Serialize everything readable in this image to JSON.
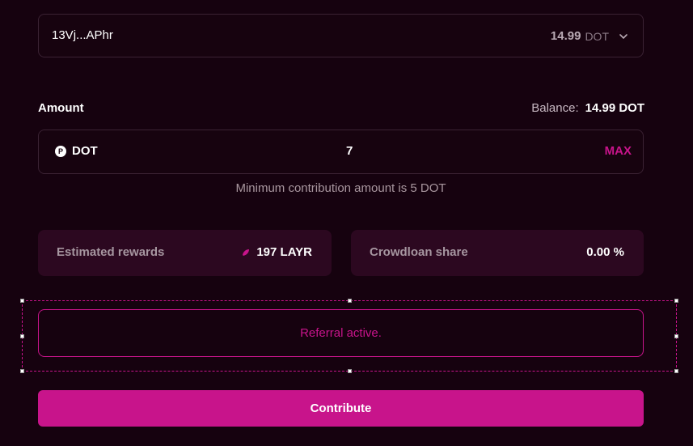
{
  "account": {
    "address": "13Vj...APhr",
    "balance_value": "14.99",
    "balance_unit": "DOT",
    "chevron_icon": "chevron-down-icon"
  },
  "amount": {
    "label": "Amount",
    "balance_label": "Balance:",
    "balance_value": "14.99 DOT",
    "token_icon": "polkadot-icon",
    "token": "DOT",
    "value": "7",
    "max_label": "MAX",
    "min_note": "Minimum contribution amount is 5 DOT"
  },
  "rewards": {
    "label": "Estimated rewards",
    "icon": "layr-leaf-icon",
    "value": "197 LAYR"
  },
  "share": {
    "label": "Crowdloan share",
    "value": "0.00 %"
  },
  "referral": {
    "text": "Referral active."
  },
  "contribute": {
    "label": "Contribute"
  },
  "colors": {
    "background": "#16020f",
    "accent": "#c8148b",
    "card": "#2c0820"
  }
}
